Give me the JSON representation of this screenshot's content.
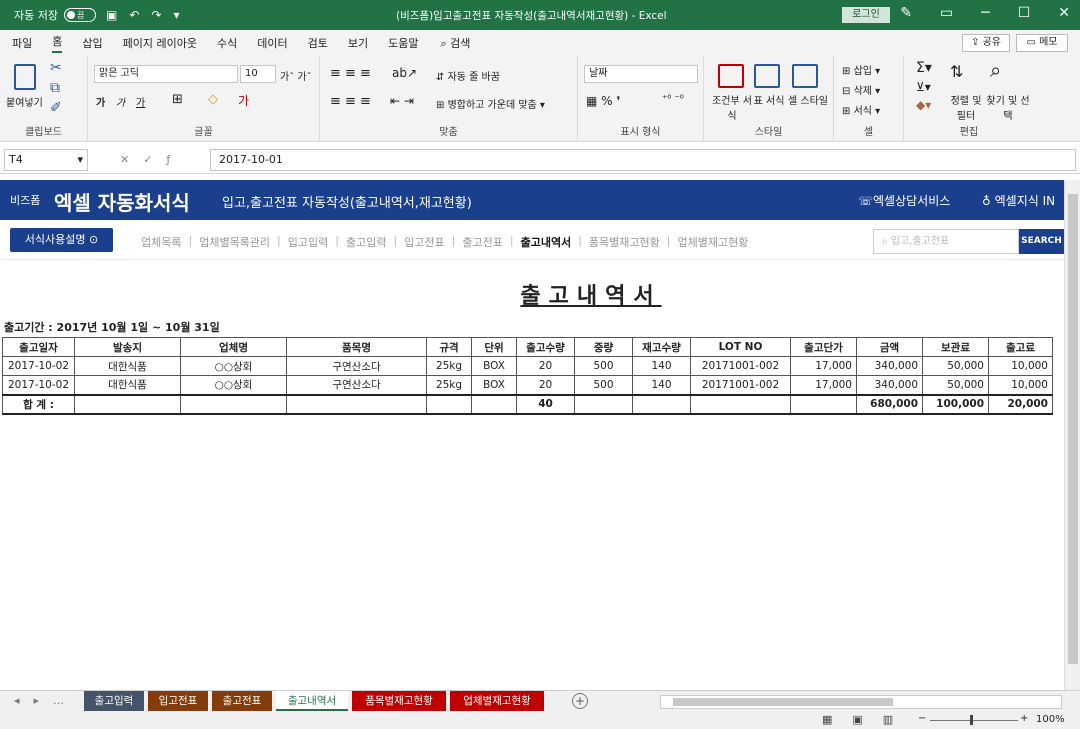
{
  "titlebar": {
    "autosave_label": "자동 저장",
    "autosave_state": "끔",
    "title": "(비즈폼)입고출고전표 자동작성(출고내역서재고현황) - Excel",
    "login_label": "로그인"
  },
  "menu": {
    "items": [
      "파일",
      "홈",
      "삽입",
      "페이지 레이아웃",
      "수식",
      "데이터",
      "검토",
      "보기",
      "도움말"
    ],
    "search_label": "검색",
    "share_label": "공유",
    "memo_label": "메모"
  },
  "ribbon": {
    "clipboard": {
      "paste": "붙여넣기",
      "label": "클립보드"
    },
    "font": {
      "name": "맑은 고딕",
      "size": "10",
      "label": "글꼴"
    },
    "align": {
      "wrap": "자동 줄 바꿈",
      "merge": "병합하고 가운데 맞춤",
      "label": "맞춤"
    },
    "number": {
      "format": "날짜",
      "label": "표시 형식"
    },
    "styles": {
      "cond": "조건부 서식",
      "table": "표 서식",
      "cell": "셀 스타일",
      "label": "스타일"
    },
    "cells": {
      "insert": "삽입",
      "delete": "삭제",
      "format": "서식",
      "label": "셀"
    },
    "editing": {
      "sort": "정렬 및 필터",
      "find": "찾기 및 선택",
      "label": "편집"
    }
  },
  "formula": {
    "cell_ref": "T4",
    "value": "2017-10-01"
  },
  "banner": {
    "brand_small": "비즈폼",
    "brand": "엑셀 자동화서식",
    "subtitle": "입고,출고전표 자동작성(출고내역서,재고현황)",
    "service": "엑셀상담서비스",
    "knowledge": "엑셀지식 IN"
  },
  "nav": {
    "guide_label": "서식사용설명 ⊙",
    "links": [
      {
        "label": "업체목록",
        "active": false
      },
      {
        "label": "업체별목록관리",
        "active": false
      },
      {
        "label": "입고입력",
        "active": false
      },
      {
        "label": "출고입력",
        "active": false
      },
      {
        "label": "입고전표",
        "active": false
      },
      {
        "label": "출고전표",
        "active": false
      },
      {
        "label": "출고내역서",
        "active": true
      },
      {
        "label": "품목별재고현황",
        "active": false
      },
      {
        "label": "업체별재고현황",
        "active": false
      }
    ],
    "search_placeholder": "입고,출고전표",
    "search_button": "SEARCH"
  },
  "report": {
    "title": "출고내역서",
    "period": "출고기간 : 2017년 10월 1일 ~ 10월 31일",
    "headers": [
      "출고일자",
      "발송지",
      "업체명",
      "품목명",
      "규격",
      "단위",
      "출고수량",
      "중량",
      "재고수량",
      "LOT NO",
      "출고단가",
      "금액",
      "보관료",
      "출고료"
    ],
    "rows": [
      [
        "2017-10-02",
        "대한식품",
        "○○상회",
        "구연산소다",
        "25kg",
        "BOX",
        "20",
        "500",
        "140",
        "20171001-002",
        "17,000",
        "340,000",
        "50,000",
        "10,000"
      ],
      [
        "2017-10-02",
        "대한식품",
        "○○상회",
        "구연산소다",
        "25kg",
        "BOX",
        "20",
        "500",
        "140",
        "20171001-002",
        "17,000",
        "340,000",
        "50,000",
        "10,000"
      ]
    ],
    "total": {
      "label": "합 계 :",
      "qty": "40",
      "amount": "680,000",
      "storage": "100,000",
      "fee": "20,000"
    }
  },
  "sheets": [
    {
      "label": "출고입력",
      "color": "#44546a"
    },
    {
      "label": "입고전표",
      "color": "#843c0c"
    },
    {
      "label": "출고전표",
      "color": "#843c0c"
    },
    {
      "label": "출고내역서",
      "color": "#ffffff"
    },
    {
      "label": "품목별재고현황",
      "color": "#c00000"
    },
    {
      "label": "업체별재고현황",
      "color": "#c00000"
    }
  ],
  "status": {
    "zoom": "100%"
  }
}
